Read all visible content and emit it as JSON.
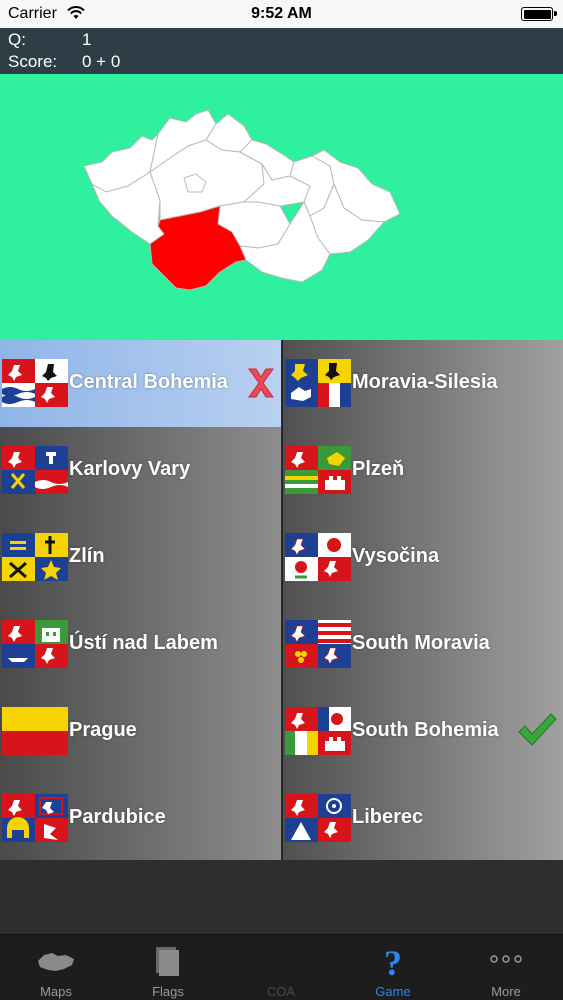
{
  "status_bar": {
    "carrier": "Carrier",
    "time": "9:52 AM"
  },
  "quiz": {
    "question_label": "Q:",
    "question_number": "1",
    "score_label": "Score:",
    "score_value": "0 + 0"
  },
  "colors": {
    "map_background": "#2ef09e",
    "highlight_region": "#ff0000",
    "active_tab": "#2a88f0"
  },
  "answers": {
    "left": [
      {
        "name": "Central Bohemia",
        "state": "selected-wrong"
      },
      {
        "name": "Karlovy Vary"
      },
      {
        "name": "Zlín"
      },
      {
        "name": "Ústí nad Labem"
      },
      {
        "name": "Prague"
      },
      {
        "name": "Pardubice"
      }
    ],
    "right": [
      {
        "name": "Moravia-Silesia"
      },
      {
        "name": "Plzeň"
      },
      {
        "name": "Vysočina"
      },
      {
        "name": "South Moravia"
      },
      {
        "name": "South Bohemia",
        "state": "correct"
      },
      {
        "name": "Liberec"
      }
    ]
  },
  "tabs": [
    {
      "label": "Maps",
      "icon": "map-icon"
    },
    {
      "label": "Flags",
      "icon": "flags-icon"
    },
    {
      "label": "COA",
      "icon": "coa-icon",
      "state": "disabled"
    },
    {
      "label": "Game",
      "icon": "question-icon",
      "state": "active"
    },
    {
      "label": "More",
      "icon": "more-icon"
    }
  ]
}
